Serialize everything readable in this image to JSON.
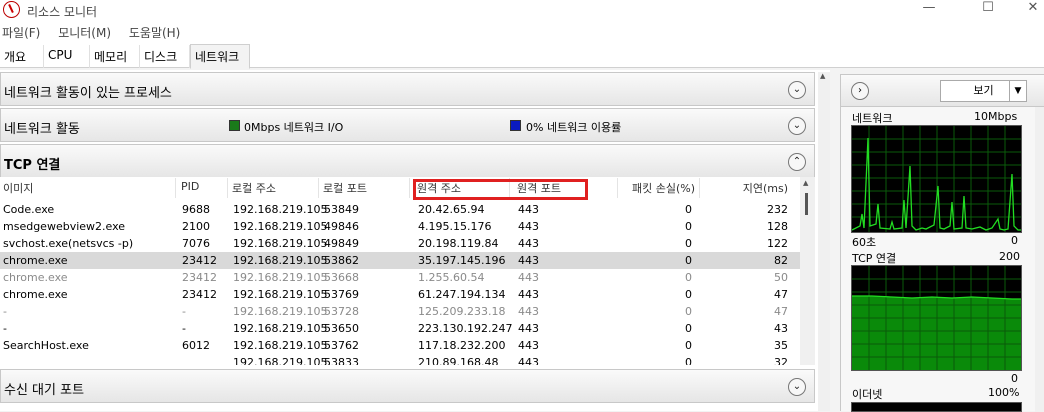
{
  "window": {
    "title": "리소스 모니터",
    "minimize": "—",
    "maximize": "☐",
    "close": "✕"
  },
  "menu": [
    "파일(F)",
    "모니터(M)",
    "도움말(H)"
  ],
  "tabs": [
    "개요",
    "CPU",
    "메모리",
    "디스크",
    "네트워크"
  ],
  "active_tab": "네트워크",
  "sections": {
    "processes": {
      "title": "네트워크 활동이 있는 프로세스",
      "chevron": "⌄"
    },
    "activity": {
      "title": "네트워크 활동",
      "io_text": "0Mbps 네트워크 I/O",
      "io_color": "#1a7a1a",
      "usage_text": "0% 네트워크 이용률",
      "usage_color": "#0a1ac0",
      "chevron": "⌄"
    },
    "tcp": {
      "title": "TCP 연결",
      "chevron": "⌃"
    },
    "listening": {
      "title": "수신 대기 포트",
      "chevron": "⌄"
    }
  },
  "tcp_table": {
    "headers": [
      "이미지",
      "PID",
      "로컬 주소",
      "로컬 포트",
      "원격 주소",
      "원격 포트",
      "패킷 손실(%)",
      "지연(ms)"
    ],
    "rows": [
      {
        "image": "Code.exe",
        "pid": "9688",
        "local_addr": "192.168.219.105",
        "local_port": "53849",
        "remote_addr": "20.42.65.94",
        "remote_port": "443",
        "loss": "0",
        "latency": "232",
        "style": ""
      },
      {
        "image": "msedgewebview2.exe",
        "pid": "2100",
        "local_addr": "192.168.219.105",
        "local_port": "49846",
        "remote_addr": "4.195.15.176",
        "remote_port": "443",
        "loss": "0",
        "latency": "128",
        "style": ""
      },
      {
        "image": "svchost.exe(netsvcs -p)",
        "pid": "7076",
        "local_addr": "192.168.219.105",
        "local_port": "49849",
        "remote_addr": "20.198.119.84",
        "remote_port": "443",
        "loss": "0",
        "latency": "122",
        "style": ""
      },
      {
        "image": "chrome.exe",
        "pid": "23412",
        "local_addr": "192.168.219.105",
        "local_port": "53862",
        "remote_addr": "35.197.145.196",
        "remote_port": "443",
        "loss": "0",
        "latency": "82",
        "style": "selected"
      },
      {
        "image": "chrome.exe",
        "pid": "23412",
        "local_addr": "192.168.219.105",
        "local_port": "53668",
        "remote_addr": "1.255.60.54",
        "remote_port": "443",
        "loss": "0",
        "latency": "50",
        "style": "dim"
      },
      {
        "image": "chrome.exe",
        "pid": "23412",
        "local_addr": "192.168.219.105",
        "local_port": "53769",
        "remote_addr": "61.247.194.134",
        "remote_port": "443",
        "loss": "0",
        "latency": "47",
        "style": ""
      },
      {
        "image": "-",
        "pid": "-",
        "local_addr": "192.168.219.105",
        "local_port": "53728",
        "remote_addr": "125.209.233.18",
        "remote_port": "443",
        "loss": "0",
        "latency": "47",
        "style": "dim"
      },
      {
        "image": "-",
        "pid": "-",
        "local_addr": "192.168.219.105",
        "local_port": "53650",
        "remote_addr": "223.130.192.247",
        "remote_port": "443",
        "loss": "0",
        "latency": "43",
        "style": ""
      },
      {
        "image": "SearchHost.exe",
        "pid": "6012",
        "local_addr": "192.168.219.105",
        "local_port": "53762",
        "remote_addr": "117.18.232.200",
        "remote_port": "443",
        "loss": "0",
        "latency": "35",
        "style": ""
      },
      {
        "image": "",
        "pid": "",
        "local_addr": "192.168.219.105",
        "local_port": "53833",
        "remote_addr": "210.89.168.48",
        "remote_port": "443",
        "loss": "0",
        "latency": "32",
        "style": ""
      }
    ]
  },
  "right_panel": {
    "view_label": "보기",
    "graphs": {
      "network": {
        "label": "네트워크",
        "max": "10Mbps",
        "time": "60초",
        "min": "0"
      },
      "tcp": {
        "label": "TCP 연결",
        "max": "200",
        "min": "0"
      },
      "ethernet": {
        "label": "이더넷",
        "max": "100%"
      }
    }
  }
}
